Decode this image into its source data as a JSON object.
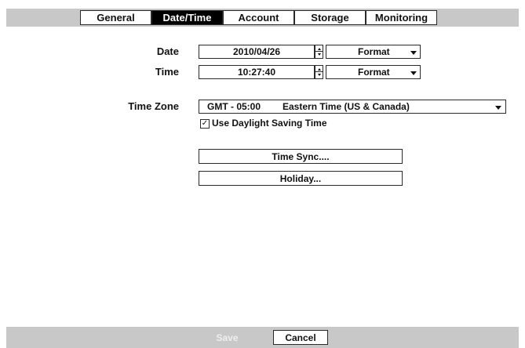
{
  "tabs": [
    {
      "label": "General",
      "active": false
    },
    {
      "label": "Date/Time",
      "active": true
    },
    {
      "label": "Account",
      "active": false
    },
    {
      "label": "Storage",
      "active": false
    },
    {
      "label": "Monitoring",
      "active": false
    }
  ],
  "date": {
    "label": "Date",
    "value": "2010/04/26",
    "format_label": "Format"
  },
  "time": {
    "label": "Time",
    "value": "10:27:40",
    "format_label": "Format"
  },
  "timezone": {
    "label": "Time Zone",
    "offset": "GMT - 05:00",
    "name": "Eastern Time (US & Canada)"
  },
  "daylight_saving": {
    "label": "Use Daylight Saving Time",
    "checked": true,
    "check_mark": "✓"
  },
  "buttons": {
    "time_sync": "Time Sync....",
    "holiday": "Holiday..."
  },
  "footer": {
    "save": "Save",
    "cancel": "Cancel"
  },
  "colors": {
    "active_tab_bg": "#000000",
    "bar_bg": "#c8c8c8",
    "save_disabled_text": "#efefef"
  }
}
